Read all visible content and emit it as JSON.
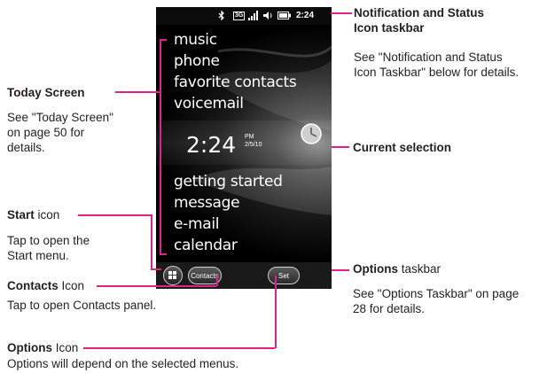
{
  "phone": {
    "status_bar": {
      "icons": [
        "bluetooth-icon",
        "3g-icon",
        "signal-icon",
        "speaker-icon",
        "battery-icon"
      ],
      "network_label": "3G",
      "time": "2:24"
    },
    "today_menu": [
      "music",
      "phone",
      "favorite contacts",
      "voicemail",
      "getting started",
      "message",
      "e-mail",
      "calendar"
    ],
    "clock": {
      "time": "2:24",
      "ampm": "PM",
      "date": "2/5/10"
    },
    "options_bar": {
      "contacts_label": "Contacts",
      "set_label": "Set"
    }
  },
  "callouts": {
    "status_title": "Notification and Status Icon taskbar",
    "status_title_line1": "Notification and Status",
    "status_title_line2": "Icon taskbar",
    "status_desc_line1": "See \"Notification and Status",
    "status_desc_line2": "Icon Taskbar\" below for details.",
    "today_title": "Today Screen",
    "today_desc_line1": "See \"Today Screen\"",
    "today_desc_line2": "on page 50 for",
    "today_desc_line3": "details.",
    "current_title": "Current selection",
    "start_title": "Start",
    "start_suffix": "icon",
    "start_desc_line1": "Tap to open the",
    "start_desc_line2": "Start menu.",
    "options_taskbar_title": "Options",
    "options_taskbar_suffix": "taskbar",
    "options_taskbar_desc_line1": "See \"Options Taskbar\" on page",
    "options_taskbar_desc_line2": "28 for details.",
    "contacts_title": "Contacts",
    "contacts_suffix": "Icon",
    "contacts_desc": "Tap to open Contacts panel.",
    "options_icon_title": "Options",
    "options_icon_suffix": "Icon",
    "options_icon_desc": "Options will depend on the selected menus."
  },
  "colors": {
    "leader_line": "#e0218a",
    "text": "#231f20",
    "phone_bg": "#000000"
  }
}
